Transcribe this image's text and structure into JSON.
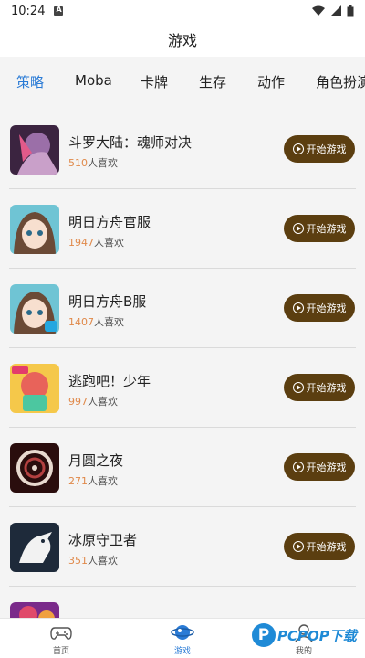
{
  "status": {
    "time": "10:24"
  },
  "appbar": {
    "title": "游戏"
  },
  "tabs": [
    {
      "label": "策略",
      "active": true
    },
    {
      "label": "Moba"
    },
    {
      "label": "卡牌"
    },
    {
      "label": "生存"
    },
    {
      "label": "动作"
    },
    {
      "label": "角色扮演"
    }
  ],
  "games": [
    {
      "name": "斗罗大陆：魂师对决",
      "likes": "510",
      "likes_suffix": "人喜欢",
      "button": "开始游戏"
    },
    {
      "name": "明日方舟官服",
      "likes": "1947",
      "likes_suffix": "人喜欢",
      "button": "开始游戏"
    },
    {
      "name": "明日方舟B服",
      "likes": "1407",
      "likes_suffix": "人喜欢",
      "button": "开始游戏"
    },
    {
      "name": "逃跑吧！少年",
      "likes": "997",
      "likes_suffix": "人喜欢",
      "button": "开始游戏"
    },
    {
      "name": "月圆之夜",
      "likes": "271",
      "likes_suffix": "人喜欢",
      "button": "开始游戏"
    },
    {
      "name": "冰原守卫者",
      "likes": "351",
      "likes_suffix": "人喜欢",
      "button": "开始游戏"
    }
  ],
  "bottom_nav": [
    {
      "label": "首页",
      "icon": "gamepad-icon"
    },
    {
      "label": "游戏",
      "icon": "game-planet-icon",
      "active": true
    },
    {
      "label": "我的",
      "icon": "profile-icon"
    }
  ],
  "watermark": {
    "letter": "P",
    "text": "PCPOP下载"
  },
  "colors": {
    "accent": "#2a7bd6",
    "button_bg": "#5b3e10",
    "likes_num": "#e0894a"
  }
}
